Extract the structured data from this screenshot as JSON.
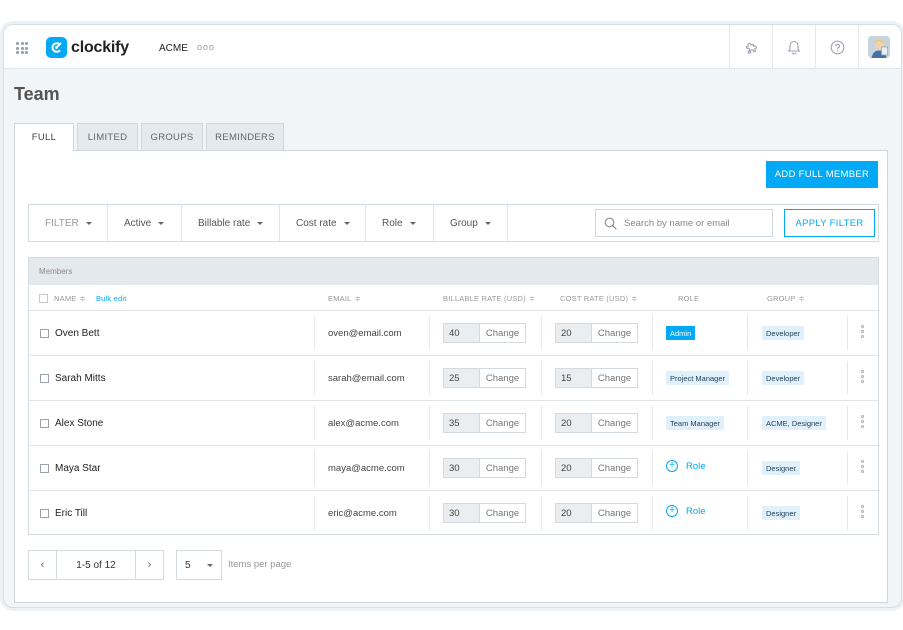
{
  "app": {
    "name": "clockify",
    "workspace": "ACME",
    "workspace_more": "ooo"
  },
  "icons": {
    "apps": "apps-grid-icon",
    "logo": "clockify-logo-icon",
    "more": "more-horizontal-icon",
    "extension": "puzzle-icon",
    "notifications": "bell-icon",
    "help": "help-circle-icon",
    "avatar": "user-avatar",
    "search": "search-icon",
    "row_menu": "kebab-menu-icon",
    "prev": "chevron-left-icon",
    "next": "chevron-right-icon"
  },
  "colors": {
    "accent": "#03a9f4",
    "badge_bg": "#e1f1fb",
    "page_bg": "#f1f5f8"
  },
  "page": {
    "title": "Team"
  },
  "tabs": [
    {
      "label": "FULL",
      "active": true
    },
    {
      "label": "LIMITED",
      "active": false
    },
    {
      "label": "GROUPS",
      "active": false
    },
    {
      "label": "REMINDERS",
      "active": false
    }
  ],
  "actions": {
    "add_member": "ADD FULL MEMBER",
    "apply_filter": "APPLY FILTER"
  },
  "filters": {
    "label": "FILTER",
    "items": [
      "Active",
      "Billable rate",
      "Cost rate",
      "Role",
      "Group"
    ],
    "search_placeholder": "Search by name or email"
  },
  "table": {
    "title": "Members",
    "columns": {
      "name": "NAME",
      "bulk_edit": "Bulk edit",
      "email": "EMAIL",
      "billable": "BILLABLE RATE (USD)",
      "cost": "COST RATE (USD)",
      "role": "ROLE",
      "group": "GROUP"
    },
    "change_label": "Change",
    "add_role_label": "Role",
    "rows": [
      {
        "name": "Oven Bett",
        "email": "oven@email.com",
        "billable": "40",
        "cost": "20",
        "role": "Admin",
        "group": "Developer"
      },
      {
        "name": "Sarah Mitts",
        "email": "sarah@email.com",
        "billable": "25",
        "cost": "15",
        "role": "Project Manager",
        "group": "Developer"
      },
      {
        "name": "Alex Stone",
        "email": "alex@acme.com",
        "billable": "35",
        "cost": "20",
        "role": "Team Manager",
        "group": "ACME, Designer"
      },
      {
        "name": "Maya Star",
        "email": "maya@acme.com",
        "billable": "30",
        "cost": "20",
        "role": "",
        "group": "Designer"
      },
      {
        "name": "Eric Till",
        "email": "eric@acme.com",
        "billable": "30",
        "cost": "20",
        "role": "",
        "group": "Designer"
      }
    ]
  },
  "pagination": {
    "range": "1-5 of 12",
    "per_page": "5",
    "per_page_label": "Items per page"
  }
}
